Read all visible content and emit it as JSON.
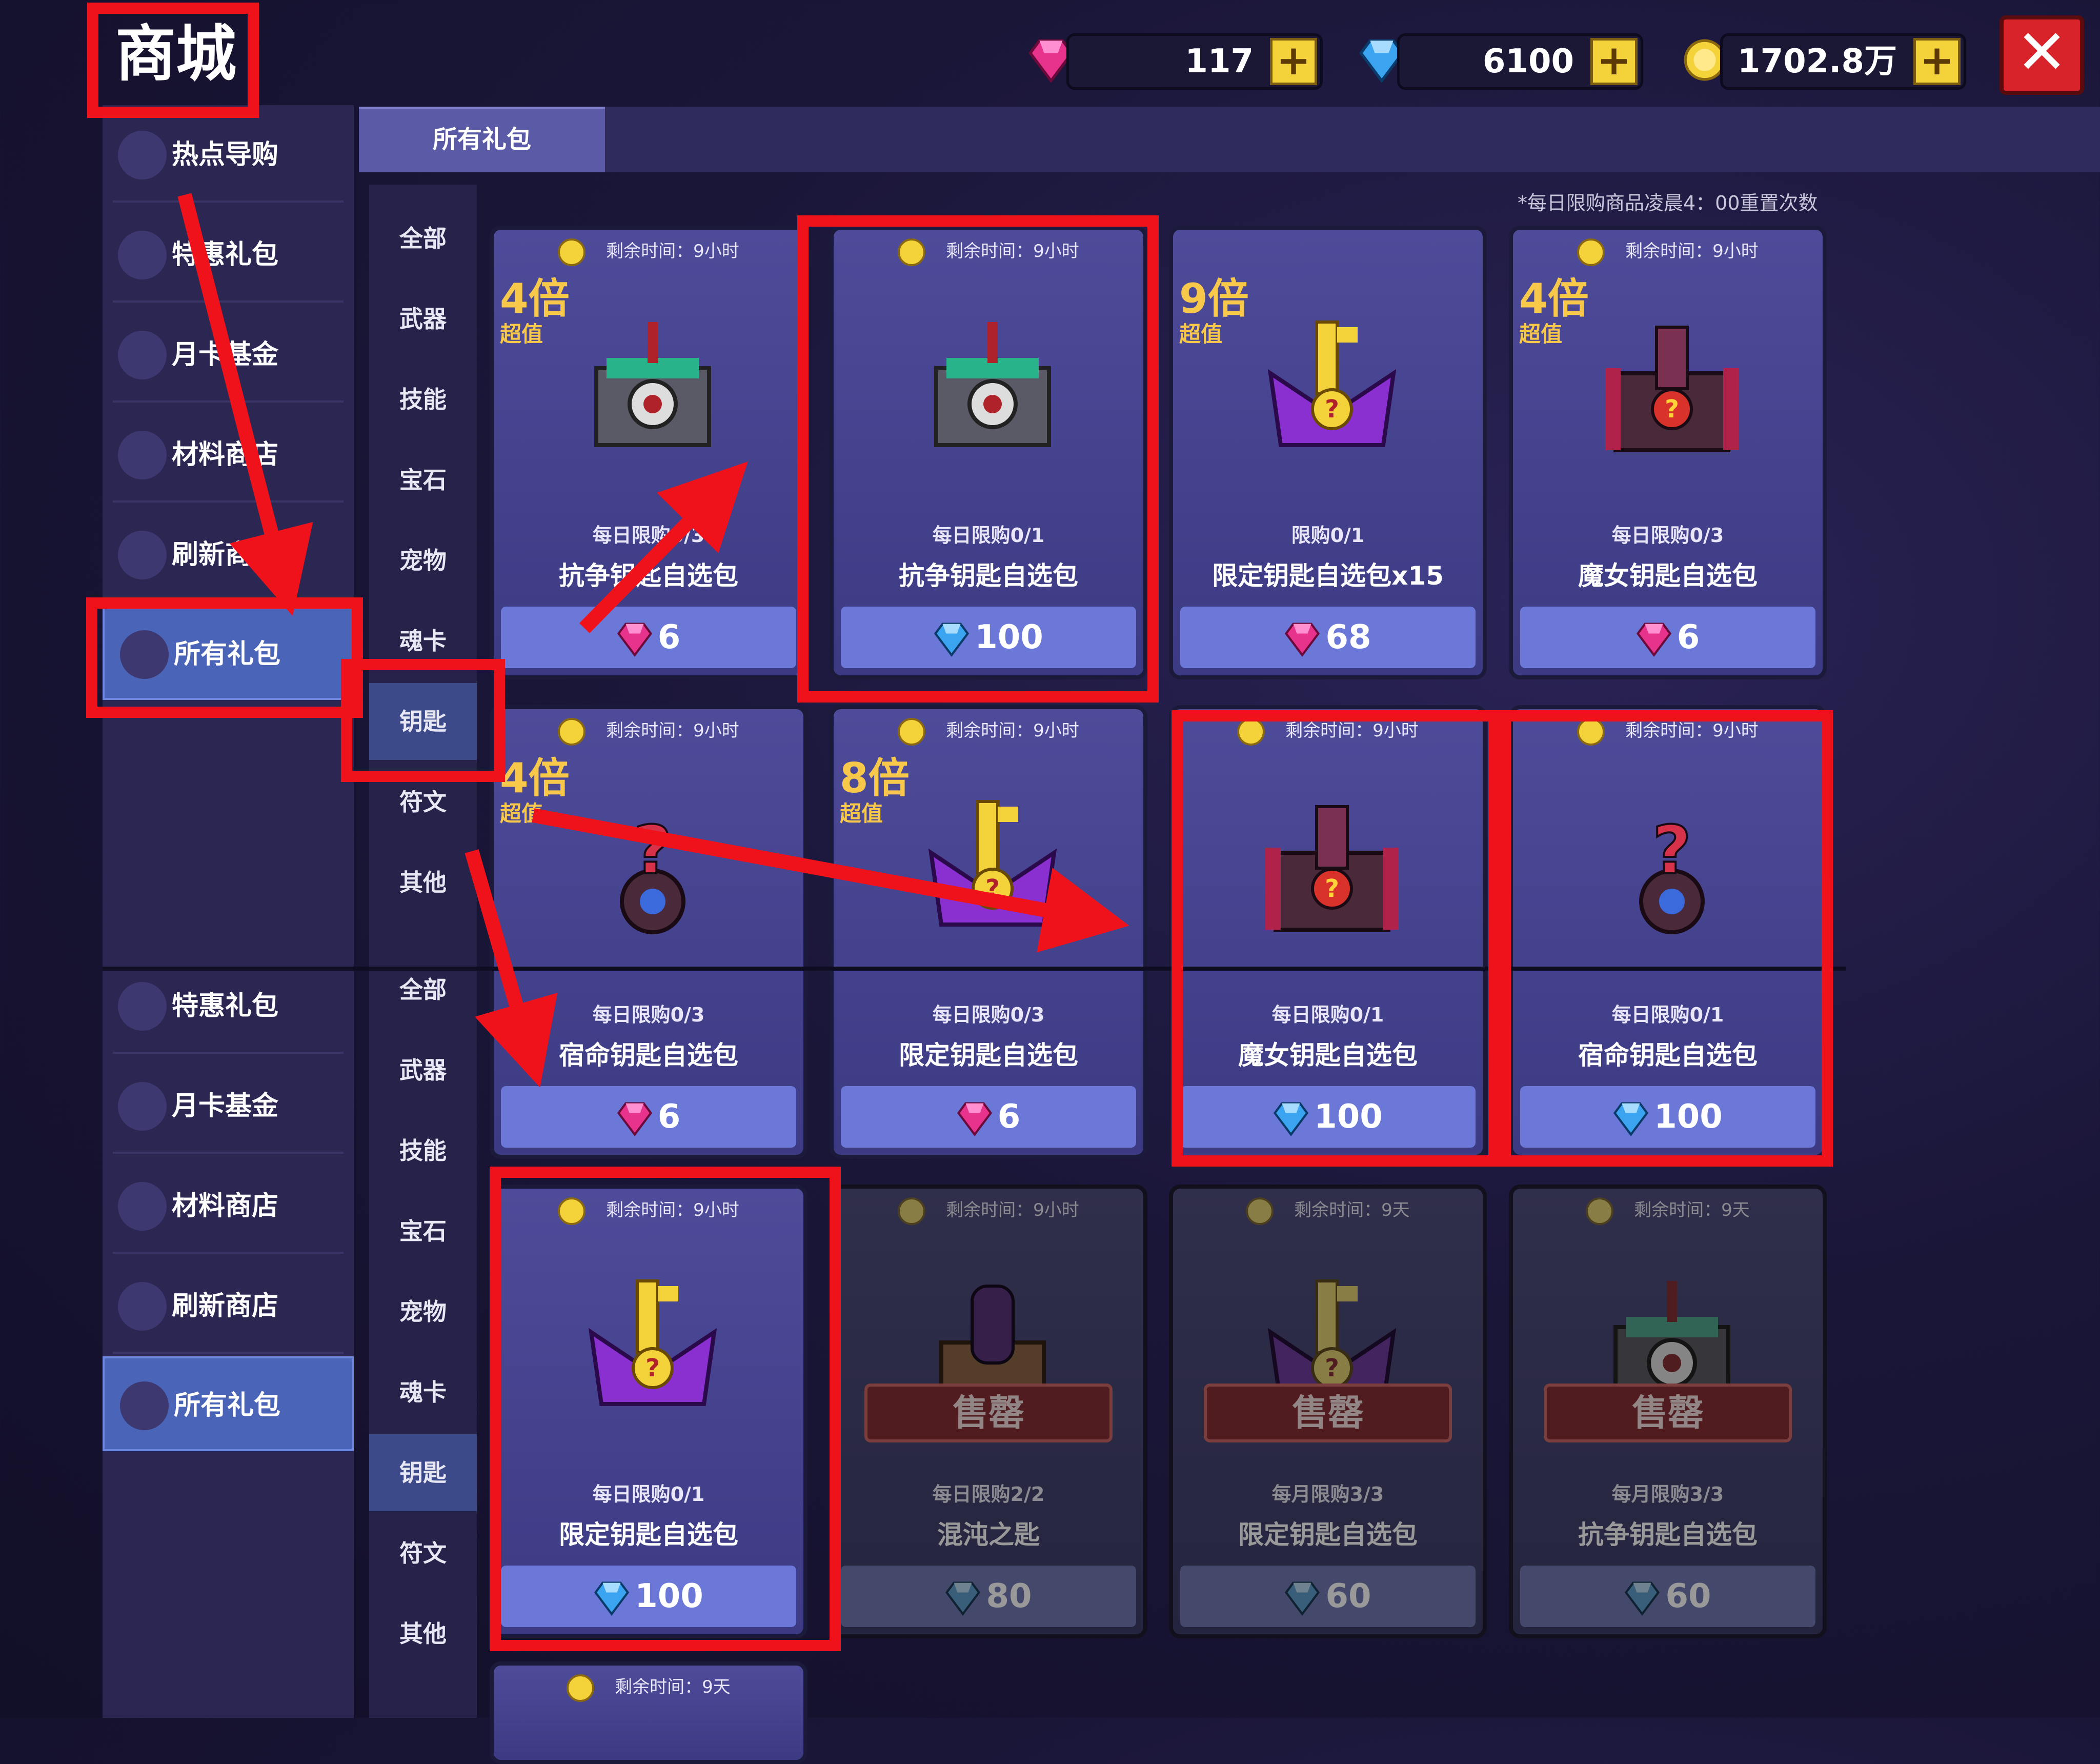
{
  "header": {
    "title": "商城",
    "currencies": [
      {
        "icon": "pink-gem-icon",
        "value": "117"
      },
      {
        "icon": "blue-diamond-icon",
        "value": "6100"
      },
      {
        "icon": "gold-coin-icon",
        "value": "1702.8万"
      }
    ],
    "plus": "+",
    "close": "✕"
  },
  "sidebar": {
    "items": [
      "热点导购",
      "特惠礼包",
      "月卡基金",
      "材料商店",
      "刷新商店",
      "所有礼包"
    ],
    "items2": [
      "特惠礼包",
      "月卡基金",
      "材料商店",
      "刷新商店",
      "所有礼包"
    ]
  },
  "tabs": {
    "active": "所有礼包"
  },
  "categories": [
    "全部",
    "武器",
    "技能",
    "宝石",
    "宠物",
    "魂卡",
    "钥匙",
    "符文",
    "其他"
  ],
  "note": "*每日限购商品凌晨4：00重置次数",
  "cards": [
    {
      "timer": "剩余时间：9小时",
      "mult": "4倍",
      "super": "超值",
      "limit": "每日限购0/3",
      "name": "抗争钥匙自选包",
      "price": "6",
      "currency": "pink",
      "art": "mech-chest-icon"
    },
    {
      "timer": "剩余时间：9小时",
      "mult": "",
      "super": "",
      "limit": "每日限购0/1",
      "name": "抗争钥匙自选包",
      "price": "100",
      "currency": "blue",
      "art": "mech-chest-icon"
    },
    {
      "timer": "",
      "mult": "9倍",
      "super": "超值",
      "limit": "限购0/1",
      "name": "限定钥匙自选包x15",
      "price": "68",
      "currency": "pink",
      "art": "purple-key-chest-icon"
    },
    {
      "timer": "剩余时间：9小时",
      "mult": "4倍",
      "super": "超值",
      "limit": "每日限购0/3",
      "name": "魔女钥匙自选包",
      "price": "6",
      "currency": "pink",
      "art": "witch-chest-icon"
    },
    {
      "timer": "剩余时间：9小时",
      "mult": "4倍",
      "super": "超值",
      "limit": "每日限购0/3",
      "name": "宿命钥匙自选包",
      "price": "6",
      "currency": "pink",
      "art": "fate-key-icon"
    },
    {
      "timer": "剩余时间：9小时",
      "mult": "8倍",
      "super": "超值",
      "limit": "每日限购0/3",
      "name": "限定钥匙自选包",
      "price": "6",
      "currency": "pink",
      "art": "purple-key-chest-icon"
    },
    {
      "timer": "剩余时间：9小时",
      "mult": "",
      "super": "",
      "limit": "每日限购0/1",
      "name": "魔女钥匙自选包",
      "price": "100",
      "currency": "blue",
      "art": "witch-chest-icon"
    },
    {
      "timer": "剩余时间：9小时",
      "mult": "",
      "super": "",
      "limit": "每日限购0/1",
      "name": "宿命钥匙自选包",
      "price": "100",
      "currency": "blue",
      "art": "fate-key-icon"
    },
    {
      "timer": "剩余时间：9小时",
      "mult": "",
      "super": "",
      "limit": "每日限购0/1",
      "name": "限定钥匙自选包",
      "price": "100",
      "currency": "blue",
      "art": "purple-key-chest-icon"
    },
    {
      "timer": "剩余时间：9小时",
      "mult": "",
      "super": "",
      "limit": "每日限购2/2",
      "name": "混沌之匙",
      "price": "80",
      "currency": "blue",
      "art": "chaos-key-icon",
      "sold": "售罄"
    },
    {
      "timer": "剩余时间：9天",
      "mult": "",
      "super": "",
      "limit": "每月限购3/3",
      "name": "限定钥匙自选包",
      "price": "60",
      "currency": "blue",
      "art": "purple-key-chest-icon",
      "sold": "售罄"
    },
    {
      "timer": "剩余时间：9天",
      "mult": "",
      "super": "",
      "limit": "每月限购3/3",
      "name": "抗争钥匙自选包",
      "price": "60",
      "currency": "blue",
      "art": "mech-chest-icon",
      "sold": "售罄"
    }
  ],
  "partial_card": {
    "timer": "剩余时间：9天"
  }
}
